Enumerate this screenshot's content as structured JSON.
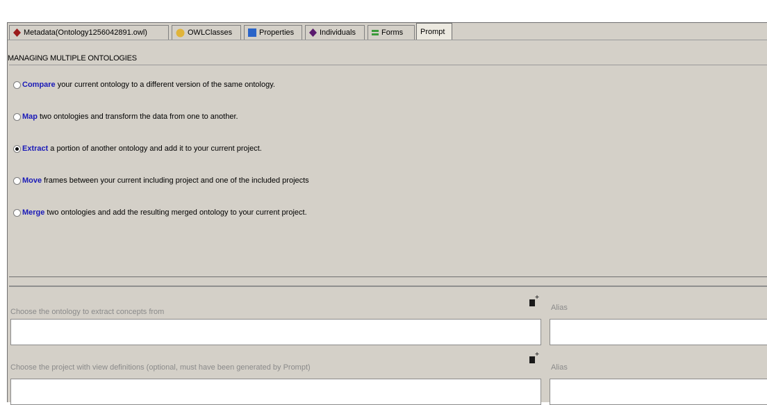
{
  "tabs": [
    {
      "label": "Metadata(Ontology1256042891.owl)",
      "icon": "red-diamond-icon",
      "color": "#9b1b1b"
    },
    {
      "label": "OWLClasses",
      "icon": "yellow-circle-icon",
      "color": "#e0b43a"
    },
    {
      "label": "Properties",
      "icon": "blue-square-icon",
      "color": "#2a64c8"
    },
    {
      "label": "Individuals",
      "icon": "purple-diamond-icon",
      "color": "#5a1a6e"
    },
    {
      "label": "Forms",
      "icon": "green-form-icon",
      "color": "#3a9a3a"
    },
    {
      "label": "Prompt",
      "active": true
    }
  ],
  "section_title": "MANAGING MULTIPLE ONTOLOGIES",
  "options": [
    {
      "keyword": "Compare",
      "text": "your current ontology to a different version of the same ontology.",
      "selected": false
    },
    {
      "keyword": "Map",
      "text": "two ontologies and transform the data from one to another.",
      "selected": false
    },
    {
      "keyword": "Extract",
      "text": "a portion of another ontology and add it to your current project.",
      "selected": true
    },
    {
      "keyword": "Move",
      "text": "frames between your current including project and one of the included projects",
      "selected": false
    },
    {
      "keyword": "Merge",
      "text": "two ontologies and add the resulting merged ontology to your current project.",
      "selected": false
    }
  ],
  "form": {
    "ontology_label": "Choose the ontology to extract concepts from",
    "ontology_value": "",
    "alias_label_1": "Alias",
    "alias_value_1": "",
    "project_label": "Choose the project with view definitions (optional, must have been generated by Prompt)",
    "project_value": "",
    "alias_label_2": "Alias",
    "alias_value_2": ""
  },
  "colors": {
    "keyword": "#1a1ab8",
    "panel": "#d4d0c8",
    "label_gray": "#8a8a8a"
  }
}
